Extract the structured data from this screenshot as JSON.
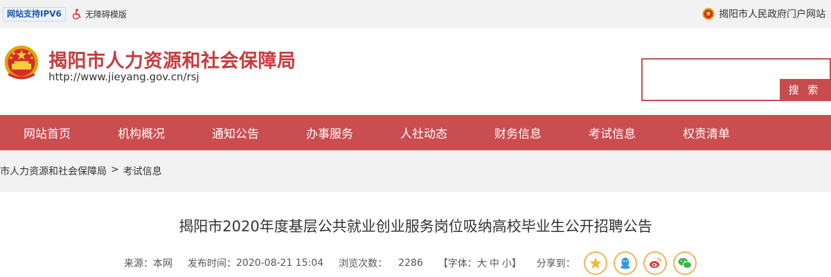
{
  "topbar": {
    "ipv6_badge": "网站支持IPV6",
    "accessibility_label": "无障碍模版",
    "gov_portal_label": "揭阳市人民政府门户网站"
  },
  "header": {
    "site_title": "揭阳市人力资源和社会保障局",
    "site_url": "http://www.jieyang.gov.cn/rsj",
    "search_placeholder": "",
    "search_button": "搜 索"
  },
  "nav": {
    "items": [
      {
        "label": "网站首页"
      },
      {
        "label": "机构概况"
      },
      {
        "label": "通知公告"
      },
      {
        "label": "办事服务"
      },
      {
        "label": "人社动态"
      },
      {
        "label": "财务信息"
      },
      {
        "label": "考试信息"
      },
      {
        "label": "权责清单"
      }
    ]
  },
  "breadcrumb": {
    "parent": "市人力资源和社会保障局",
    "separator": ">",
    "current": "考试信息"
  },
  "article": {
    "title": "揭阳市2020年度基层公共就业创业服务岗位吸纳高校毕业生公开招聘公告",
    "source_label": "来源：",
    "source_value": "本网",
    "published_label": "发布时间：",
    "published_value": "2020-08-21 15:04",
    "views_label": "浏览次数：",
    "views_value": "2286",
    "font_label": "【字体：",
    "font_large": "大",
    "font_medium": "中",
    "font_small": "小",
    "font_close": "】",
    "share_label": "分享到："
  },
  "share_icons": [
    "qzone-star-icon",
    "qq-penguin-icon",
    "weibo-icon",
    "wechat-icon"
  ],
  "colors": {
    "brand_red": "#ca4d50",
    "title_red": "#c73a3e",
    "topbar_bg": "#f2f2f2",
    "share_ring": "#f0b15b"
  }
}
